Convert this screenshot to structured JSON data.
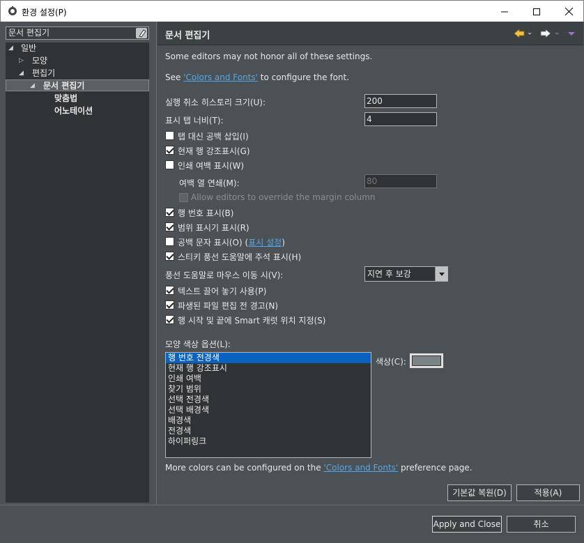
{
  "window": {
    "title": "환경 설정(P)",
    "controls": {
      "minimize": "—",
      "maximize": "☐",
      "close": "✕"
    }
  },
  "filter": {
    "value": "문서 편집기"
  },
  "tree": [
    {
      "label": "일반",
      "level": 0,
      "expanded": true
    },
    {
      "label": "모양",
      "level": 1,
      "expanded": false
    },
    {
      "label": "편집기",
      "level": 1,
      "expanded": true
    },
    {
      "label": "문서 편집기",
      "level": 2,
      "expanded": true,
      "selected": true
    },
    {
      "label": "맞춤법",
      "level": 3
    },
    {
      "label": "어노테이션",
      "level": 3
    }
  ],
  "page": {
    "title": "문서 편집기",
    "note": "Some editors may not honor all of these settings.",
    "see_prefix": "See ",
    "see_link": "'Colors and Fonts'",
    "see_suffix": " to configure the font.",
    "undo_label": "실행 취소 히스토리 크기(U):",
    "undo_value": "200",
    "tab_label": "표시 탭 너비(T):",
    "tab_value": "4",
    "insert_spaces": "탭 대신 공백 삽입(I)",
    "highlight_line": "현재 행 강조표시(G)",
    "print_margin": "인쇄 여백 표시(W)",
    "margin_col_label": "여백 열 연쇄(M):",
    "margin_col_value": "80",
    "allow_override": "Allow editors to override the margin column",
    "line_numbers": "행 번호 표시(B)",
    "range_indicator": "범위 표시기 표시(R)",
    "whitespace": "공백 문자 표시(O)",
    "whitespace_open": "(",
    "whitespace_link": "표시 설정",
    "whitespace_close": ")",
    "sticky_hover": "스티키 풍선 도움말에 주석 표시(H)",
    "hover_label": "풍선 도움말로 마우스 이동 시(V):",
    "hover_value": "지연 후 보강",
    "dnd": "텍스트 끌어 놓기 사용(P)",
    "derived_warn": "파생된 파일 편집 전 경고(N)",
    "smart_caret": "행 시작 및 끝에 Smart 캐럿 위치 지정(S)",
    "colors_label": "모양 색상 옵션(L):",
    "colors_list": [
      "행 번호 전경색",
      "현재 행 강조표시",
      "인쇄 여백",
      "찾기 범위",
      "선택 전경색",
      "선택 배경색",
      "배경색",
      "전경색",
      "하이퍼링크"
    ],
    "color_label": "색상(C):",
    "color_value": "#7a8386",
    "more_prefix": "More colors can be configured on the ",
    "more_link": "'Colors and Fonts'",
    "more_suffix": " preference page.",
    "restore_defaults": "기본값 복원(D)",
    "apply": "적용(A)"
  },
  "checks": {
    "insert_spaces": false,
    "highlight_line": true,
    "print_margin": false,
    "allow_override": false,
    "line_numbers": true,
    "range_indicator": true,
    "whitespace": false,
    "sticky_hover": true,
    "dnd": true,
    "derived_warn": true,
    "smart_caret": true
  },
  "footer": {
    "apply_close": "Apply and Close",
    "cancel": "취소"
  },
  "colors": {
    "link": "#53a7e8",
    "selection": "#0a62c0",
    "panel": "#4b5155",
    "field": "#2f3336"
  }
}
